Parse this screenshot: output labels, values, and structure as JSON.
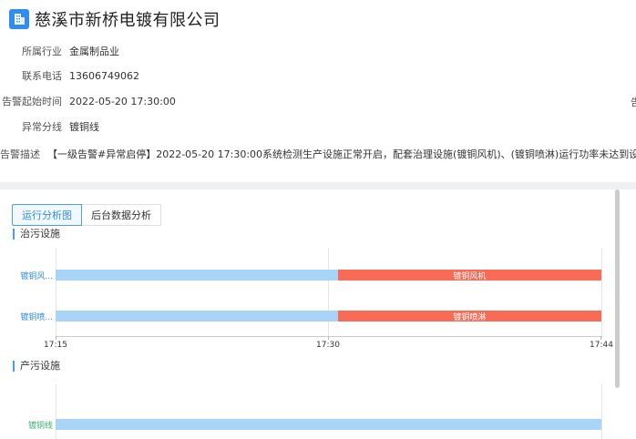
{
  "company": {
    "name": "慈溪市新桥电镀有限公司"
  },
  "info": {
    "rows": [
      {
        "label": "所属行业",
        "value": "金属制品业"
      },
      {
        "label": "联系电话",
        "value": "13606749062"
      },
      {
        "label": "告警起始时间",
        "value": "2022-05-20 17:30:00"
      },
      {
        "label": "异常分线",
        "value": "镀铜线"
      },
      {
        "label": "告警描述",
        "value": "【一级告警#异常启停】2022-05-20 17:30:00系统检测生产设施正常开启，配套治理设施(镀铜风机)、(镀铜喷淋)运行功率未达到设定额定值"
      }
    ],
    "edge_char": "告"
  },
  "tabs": [
    {
      "label": "运行分析图",
      "active": true
    },
    {
      "label": "后台数据分析",
      "active": false
    }
  ],
  "chart_data": [
    {
      "type": "bar",
      "title": "治污设施",
      "x_ticks": [
        "17:15",
        "17:30",
        "17:44"
      ],
      "series": [
        {
          "name": "镀铜风...",
          "bar_label": "镀铜风机",
          "normal_range": [
            "17:15",
            "17:30"
          ],
          "alarm_range": [
            "17:30",
            "17:44"
          ]
        },
        {
          "name": "镀铜喷...",
          "bar_label": "镀铜喷淋",
          "normal_range": [
            "17:15",
            "17:30"
          ],
          "alarm_range": [
            "17:30",
            "17:44"
          ]
        }
      ],
      "colors": {
        "normal": "#a8d5f7",
        "alarm": "#f76b57"
      }
    },
    {
      "type": "bar",
      "title": "产污设施",
      "series": [
        {
          "name": "镀铜线",
          "normal_range": [
            "17:15",
            "17:44"
          ]
        }
      ],
      "colors": {
        "normal": "#a8d5f7"
      }
    }
  ]
}
